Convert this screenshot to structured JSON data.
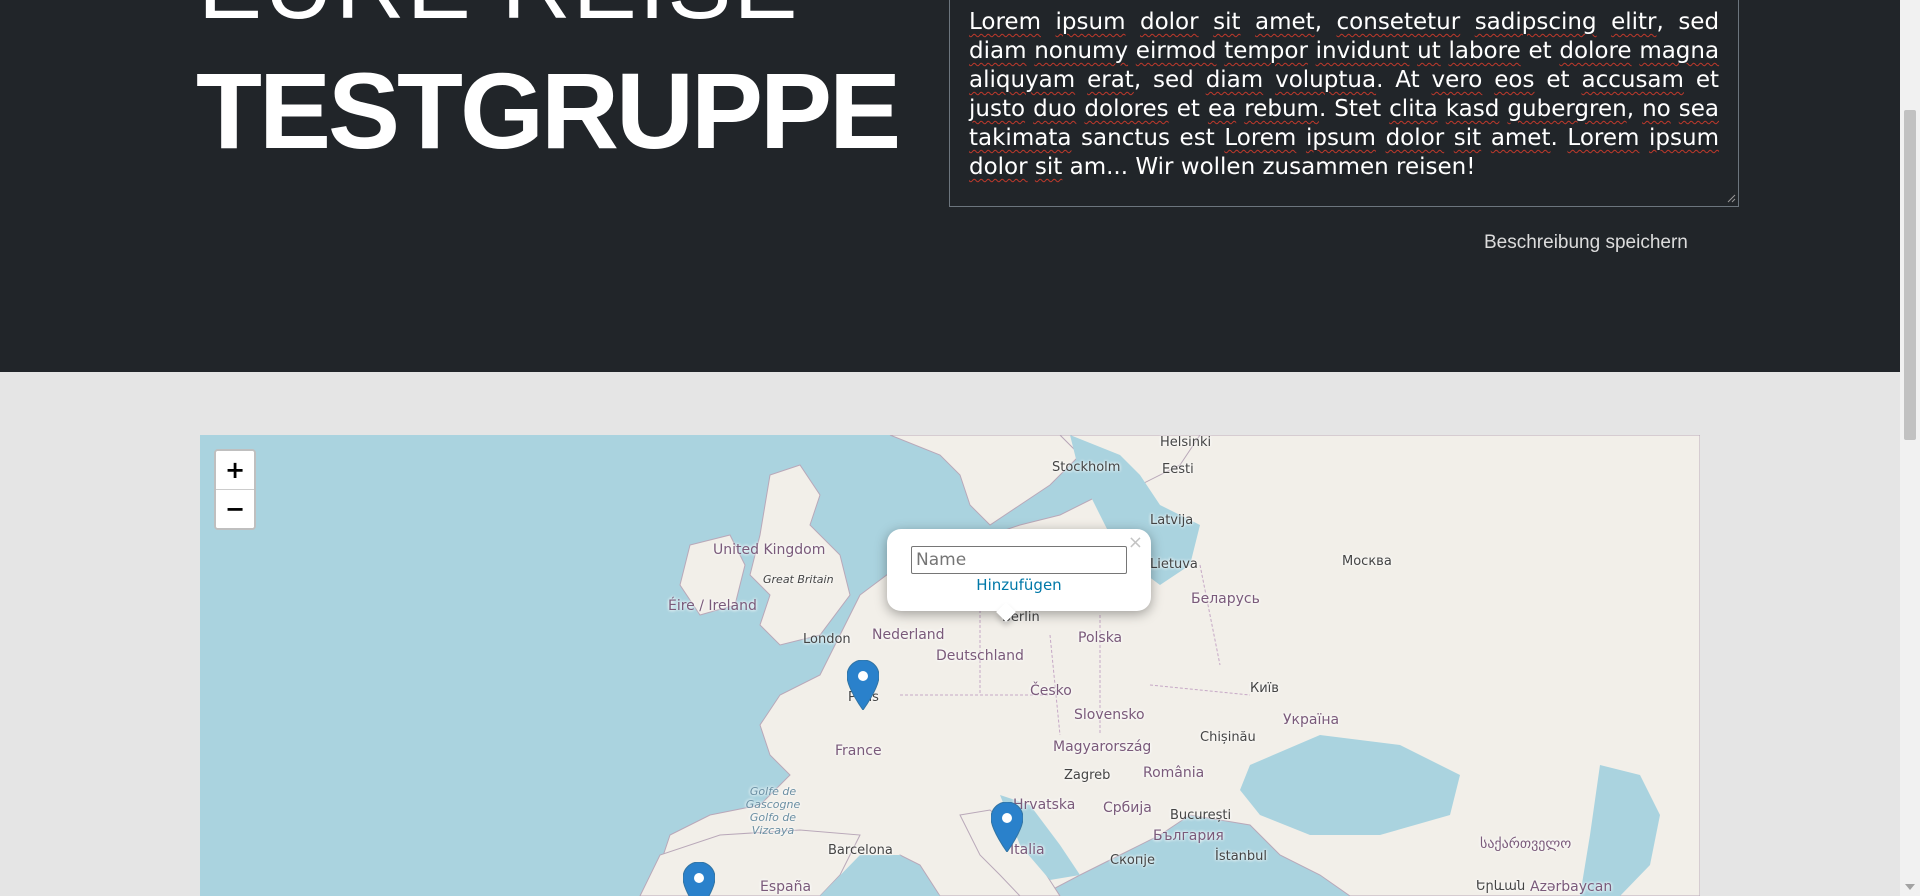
{
  "hero": {
    "kicker": "EURE REISE",
    "group_name": "TESTGRUPPE",
    "description_words": [
      [
        "Lorem",
        true
      ],
      [
        " ",
        false
      ],
      [
        "ipsum",
        true
      ],
      [
        " ",
        false
      ],
      [
        "dolor",
        true
      ],
      [
        " ",
        false
      ],
      [
        "sit",
        true
      ],
      [
        " ",
        false
      ],
      [
        "amet",
        true
      ],
      [
        ", ",
        false
      ],
      [
        "consetetur",
        true
      ],
      [
        " ",
        false
      ],
      [
        "sadipscing",
        true
      ],
      [
        " ",
        false
      ],
      [
        "elitr",
        true
      ],
      [
        ", sed ",
        false
      ],
      [
        "diam",
        true
      ],
      [
        " ",
        false
      ],
      [
        "nonumy",
        true
      ],
      [
        " ",
        false
      ],
      [
        "eirmod",
        true
      ],
      [
        " ",
        false
      ],
      [
        "tempor",
        true
      ],
      [
        " ",
        false
      ],
      [
        "invidunt",
        true
      ],
      [
        " ",
        false
      ],
      [
        "ut",
        true
      ],
      [
        " ",
        false
      ],
      [
        "labore",
        true
      ],
      [
        " et ",
        false
      ],
      [
        "dolore",
        true
      ],
      [
        " ",
        false
      ],
      [
        "magna",
        true
      ],
      [
        " ",
        false
      ],
      [
        "aliquyam",
        true
      ],
      [
        " ",
        false
      ],
      [
        "erat",
        true
      ],
      [
        ", sed ",
        false
      ],
      [
        "diam",
        true
      ],
      [
        " ",
        false
      ],
      [
        "voluptua",
        true
      ],
      [
        ". At ",
        false
      ],
      [
        "vero",
        true
      ],
      [
        " ",
        false
      ],
      [
        "eos",
        true
      ],
      [
        " et ",
        false
      ],
      [
        "accusam",
        true
      ],
      [
        " et ",
        false
      ],
      [
        "justo",
        true
      ],
      [
        " ",
        false
      ],
      [
        "duo",
        true
      ],
      [
        " ",
        false
      ],
      [
        "dolores",
        true
      ],
      [
        " et ",
        false
      ],
      [
        "ea",
        true
      ],
      [
        " ",
        false
      ],
      [
        "rebum",
        true
      ],
      [
        ". Stet ",
        false
      ],
      [
        "clita",
        true
      ],
      [
        " ",
        false
      ],
      [
        "kasd",
        true
      ],
      [
        " ",
        false
      ],
      [
        "gubergren",
        true
      ],
      [
        ", ",
        false
      ],
      [
        "no",
        true
      ],
      [
        " ",
        false
      ],
      [
        "sea",
        true
      ],
      [
        " ",
        false
      ],
      [
        "takimata",
        true
      ],
      [
        " sanctus est ",
        false
      ],
      [
        "Lorem",
        true
      ],
      [
        " ",
        false
      ],
      [
        "ipsum",
        true
      ],
      [
        " ",
        false
      ],
      [
        "dolor",
        true
      ],
      [
        " ",
        false
      ],
      [
        "sit",
        true
      ],
      [
        " ",
        false
      ],
      [
        "amet",
        true
      ],
      [
        ". ",
        false
      ],
      [
        "Lorem",
        true
      ],
      [
        " ",
        false
      ],
      [
        "ipsum",
        true
      ],
      [
        " ",
        false
      ],
      [
        "dolor",
        true
      ],
      [
        " ",
        false
      ],
      [
        "sit",
        true
      ],
      [
        " am... Wir wollen zusammen reisen!",
        false
      ]
    ],
    "save_label": "Beschreibung speichern"
  },
  "map": {
    "zoom_in": "+",
    "zoom_out": "−",
    "popup": {
      "close": "×",
      "name_placeholder": "Name",
      "add_label": "Hinzufügen"
    },
    "labels": {
      "helsinki": "Helsinki",
      "stockholm": "Stockholm",
      "eesti": "Eesti",
      "latvija": "Latvija",
      "lietuva": "Lietuva",
      "moskva": "Москва",
      "belarus": "Беларусь",
      "uk": "United Kingdom",
      "gb": "Great Britain",
      "eire": "Éire / Ireland",
      "london": "London",
      "nederland": "Nederland",
      "berlin": "Berlin",
      "polska": "Polska",
      "deutschland": "Deutschland",
      "paris": "Paris",
      "cesko": "Česko",
      "kyiv": "Київ",
      "slovensko": "Slovensko",
      "ukraina": "Україна",
      "france": "France",
      "chisinau": "Chișinău",
      "magyarorszag": "Magyarország",
      "golfe": "Golfe de Gascogne Golfo de Vizcaya",
      "zagreb": "Zagreb",
      "romania": "România",
      "hrvatska": "Hrvatska",
      "srbija": "Србија",
      "bucuresti": "București",
      "bulgaria": "България",
      "barcelona": "Barcelona",
      "italia": "Italia",
      "skopje": "Скопје",
      "istanbul": "İstanbul",
      "sakartvelo": "საქართველო",
      "espana": "España",
      "yerevan": "Երևան",
      "azerbaycan": "Azərbaycan"
    }
  }
}
